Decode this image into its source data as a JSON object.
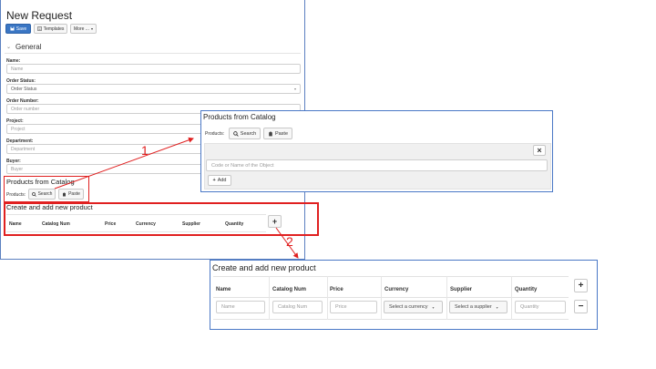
{
  "form": {
    "title": "New Request",
    "toolbar": {
      "save": "Save",
      "templates": "Templates",
      "more": "More ..."
    },
    "section": "General",
    "fields": [
      {
        "label": "Name:",
        "placeholder": "Name"
      },
      {
        "label": "Order Status:",
        "placeholder": "Order Status"
      },
      {
        "label": "Order Number:",
        "placeholder": "Order number"
      },
      {
        "label": "Project:",
        "placeholder": "Project"
      },
      {
        "label": "Department:",
        "placeholder": "Department"
      },
      {
        "label": "Buyer:",
        "placeholder": "Buyer"
      }
    ],
    "catalog": {
      "title": "Products from Catalog",
      "products_label": "Products:",
      "search": "Search",
      "paste": "Paste"
    },
    "create": {
      "title": "Create and add new product",
      "columns": [
        "Name",
        "Catalog Num",
        "Price",
        "Currency",
        "Supplier",
        "Quantity"
      ],
      "add": "+"
    }
  },
  "annotations": {
    "label1": "1",
    "label2": "2",
    "color": "#e02020"
  },
  "catalog_popup": {
    "title": "Products from Catalog",
    "products_label": "Products:",
    "search": "Search",
    "paste": "Paste",
    "close": "×",
    "input_placeholder": "Code or Name of the Object",
    "add": "Add"
  },
  "product_popup": {
    "title": "Create and add new product",
    "columns": [
      "Name",
      "Catalog Num",
      "Price",
      "Currency",
      "Supplier",
      "Quantity"
    ],
    "placeholders": [
      "Name",
      "Catalog Num",
      "Price",
      "Select a currency",
      "Select a supplier",
      "Quantity"
    ],
    "add": "+",
    "remove": "−"
  }
}
